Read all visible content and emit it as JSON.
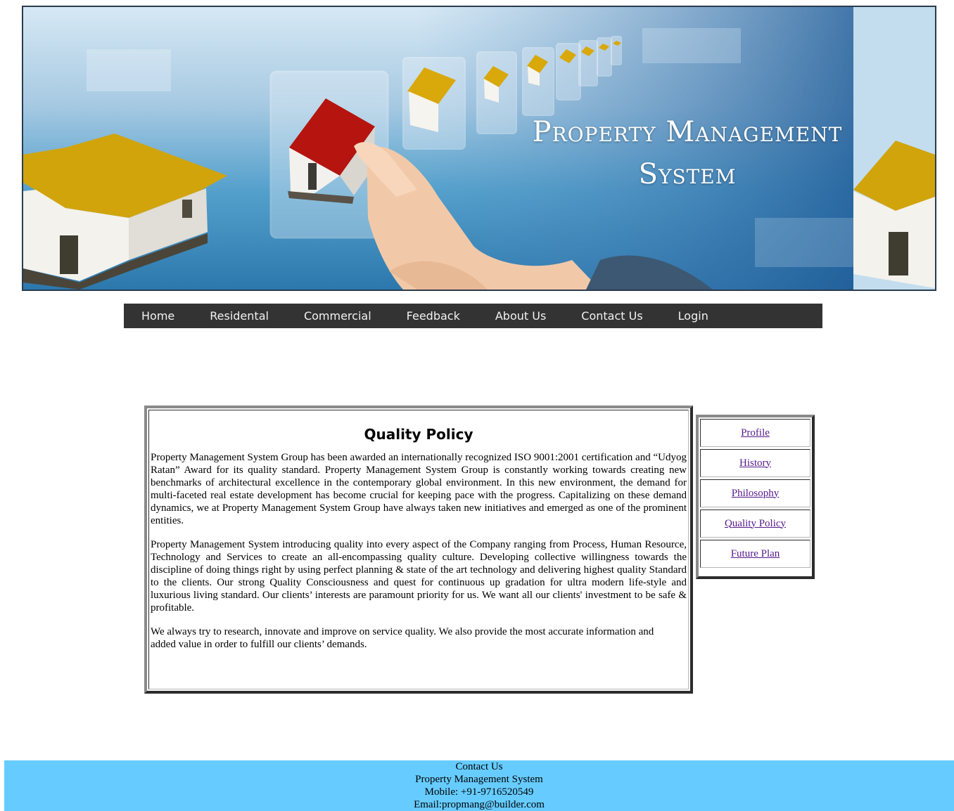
{
  "banner": {
    "title_line1": "Property Management",
    "title_line2": "System"
  },
  "nav": {
    "items": [
      "Home",
      "Residental",
      "Commercial",
      "Feedback",
      "About Us",
      "Contact Us",
      "Login"
    ]
  },
  "content": {
    "title": "Quality Policy",
    "paragraphs": [
      "Property Management System Group has been awarded an internationally recognized ISO 9001:2001 certification and “Udyog Ratan” Award for its quality standard. Property Management System Group is constantly working towards creating new benchmarks of architectural excellence in the contemporary global environment. In this new environment, the demand for multi-faceted real estate development has become crucial for keeping pace with the progress. Capitalizing on these demand dynamics, we at Property Management System Group have always taken new initiatives and emerged as one of the prominent entities.",
      "Property Management System introducing quality into every aspect of the Company ranging from Process, Human Resource, Technology and Services to create an all-encompassing quality culture. Developing collective willingness towards the discipline of doing things right by using perfect planning & state of the art technology and delivering highest quality Standard to the clients. Our strong Quality Consciousness and quest for continuous up gradation for ultra modern life-style and luxurious living standard. Our clients’ interests are paramount priority for us. We want all our clients' investment to be safe & profitable.",
      "We always try to research, innovate and improve on service quality. We also provide the most accurate information and added value in order to fulfill our clients’ demands."
    ]
  },
  "sidebar": {
    "items": [
      "Profile",
      "History",
      "Philosophy",
      "Quality Policy",
      "Future Plan"
    ]
  },
  "footer": {
    "heading": "Contact Us",
    "company": "Property Management System",
    "mobile": "Mobile: +91-9716520549",
    "email": "Email:propmang@builder.com"
  },
  "colors": {
    "nav_bg": "#333333",
    "footer_bg": "#66ccff",
    "link_visited": "#551a8b"
  }
}
